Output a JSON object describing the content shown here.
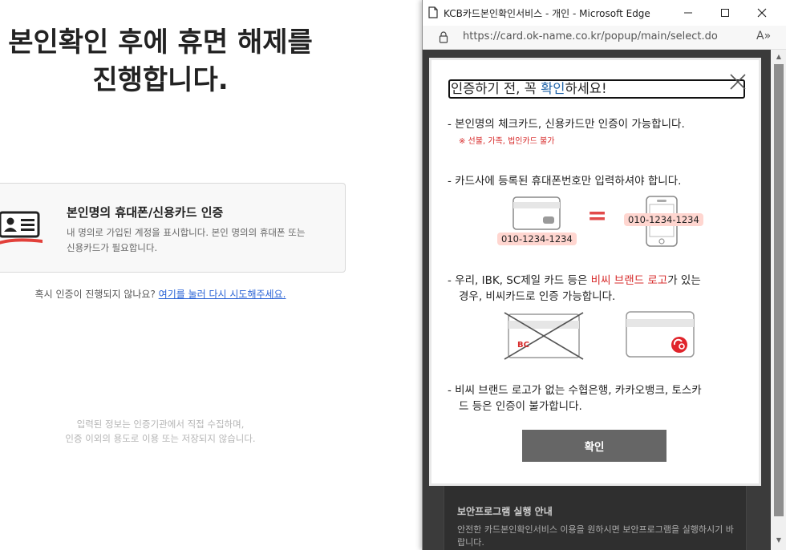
{
  "background": {
    "title_line1": "본인확인 후에 휴면 해제를",
    "title_line2": "진행합니다.",
    "card": {
      "title": "본인명의 휴대폰/신용카드 인증",
      "desc_line1": "내 명의로 가입된 계정을 표시합니다. 본인 명의의 휴대폰 또는",
      "desc_line2": "신용카드가 필요합니다."
    },
    "retry_text": "혹시 인증이 진행되지 않나요?",
    "retry_link": "여기를 눌러 다시 시도해주세요.",
    "note_line1": "입력된 정보는 인증기관에서 직접 수집하며,",
    "note_line2": "인증 이외의 용도로 이용 또는 저장되지 않습니다."
  },
  "window": {
    "title": "KCB카드본인확인서비스 - 개인 - Microsoft Edge",
    "url": "https://card.ok-name.co.kr/popup/main/select.do",
    "read_aloud": "A»"
  },
  "modal": {
    "heading_pre": "인증하기 전, 꼭 ",
    "heading_hl": "확인",
    "heading_post": "하세요!",
    "item1": "- 본인명의 체크카드, 신용카드만 인증이 가능합니다.",
    "item1_sub": "※ 선불, 가족, 법인카드 불가",
    "item2": "- 카드사에 등록된 휴대폰번호만 입력하셔야 합니다.",
    "phone_number_card": "010-1234-1234",
    "phone_number_phone": "010-1234-1234",
    "equals": "=",
    "item3_pre": "- 우리, IBK, SC제일 카드 등은 ",
    "item3_red": "비씨 브랜드 로고",
    "item3_post": "가 있는",
    "item3_line2": "경우, 비씨카드로 인증 가능합니다.",
    "bc_label": "BC",
    "item4_line1": "- 비씨 브랜드 로고가 없는 수협은행, 카카오뱅크, 토스카",
    "item4_line2": "드 등은 인증이 불가합니다.",
    "ok_button": "확인"
  },
  "underlay": {
    "title": "보안프로그램 실행 안내",
    "desc": "안전한 카드본인확인서비스 이용을 원하시면 보안프로그램을 실행하시기 바랍니다."
  },
  "colors": {
    "accent_red": "#d72b2b",
    "heading_blue": "#1d62a8",
    "pill_bg": "#ffd6d0",
    "button_gray": "#666666"
  }
}
